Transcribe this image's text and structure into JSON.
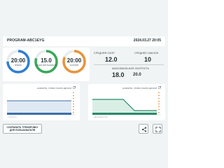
{
  "header": {
    "title": "PROGRAM-ABC1EYG",
    "datetime": "2024.03.27 20:05"
  },
  "gauges": [
    {
      "value": "20:00",
      "label": "ВРЕМЯ",
      "color": "#2f7fd1",
      "fill": 0.75
    },
    {
      "value": "15.0",
      "label": "ОБЩАЯ ДИСТАНЦИЯ КМ",
      "color": "#3aa85a",
      "fill": 0.8
    },
    {
      "value": "20:00",
      "label": "КАЛОРИИ",
      "color": "#e8943a",
      "fill": 0.82
    }
  ],
  "stats": {
    "avg_speed_label": "СРЕДНЯЯ СКОР.",
    "avg_speed_value": "12.0",
    "avg_incline_label": "СРЕДНЕЕ НАКЛОН",
    "avg_incline_value": "10",
    "max_speed_label": "МАКСИМАЛЬНАЯ СКОРОСТЬ",
    "max_speed_value": "18.0",
    "max_speed_value2": "20.0"
  },
  "charts": [
    {
      "hint": "НАЖМИТЕ, ЧТОБЫ УЗНАТЬ ДЕТАЛИ",
      "xlabel": "СКОРОСТЬ",
      "color": "#3f6fa8",
      "fill": "#dfe9f3"
    },
    {
      "hint": "НАЖМИТЕ, ЧТОБЫ УЗНАТЬ ДЕТАЛИ",
      "xlabel": "НАКЛОН/ВЫСОТА",
      "color": "#2a8a6a",
      "fill": "#d9efe6"
    }
  ],
  "footer": {
    "save_label": "СОХРАНИТЬ ТРЕНИРОВКУ ДЛЯ ПОЛЬЗОВАТЕЛЯ"
  },
  "icons": [
    "share-icon",
    "fullscreen-icon",
    "expand-icon"
  ]
}
